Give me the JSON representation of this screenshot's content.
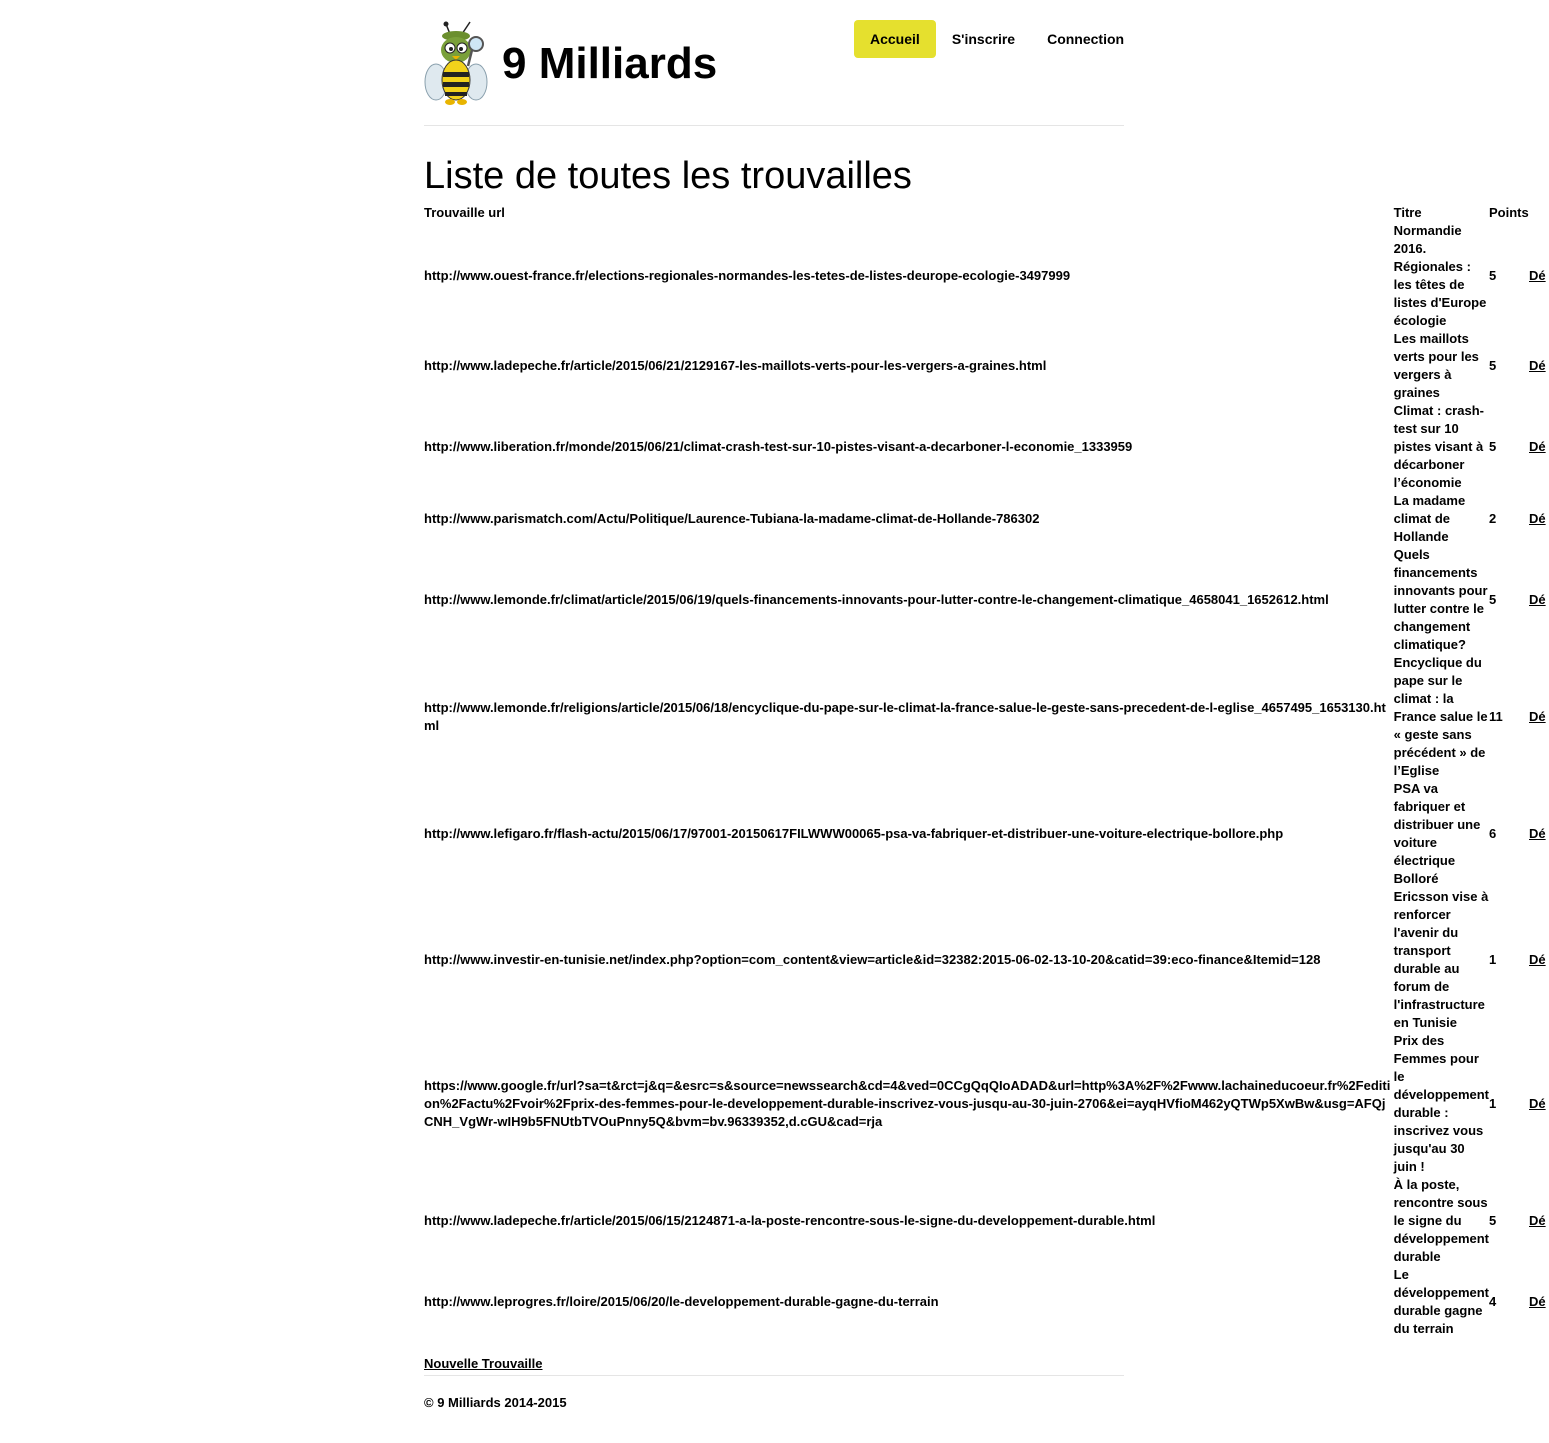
{
  "header": {
    "brand": "9 Milliards",
    "logo_icon": "bee-detective-icon",
    "nav": [
      {
        "label": "Accueil",
        "active": true
      },
      {
        "label": "S'inscrire",
        "active": false
      },
      {
        "label": "Connection",
        "active": false
      }
    ],
    "accent_color": "#e5e02e"
  },
  "main": {
    "title": "Liste de toutes les trouvailles",
    "table": {
      "headers": {
        "url": "Trouvaille url",
        "titre": "Titre",
        "points": "Points"
      },
      "rows": [
        {
          "url": "http://www.ouest-france.fr/elections-regionales-normandes-les-tetes-de-listes-deurope-ecologie-3497999",
          "titre": "Normandie 2016. Régionales : les têtes de listes d'Europe écologie",
          "points": "5",
          "action": "Dé"
        },
        {
          "url": "http://www.ladepeche.fr/article/2015/06/21/2129167-les-maillots-verts-pour-les-vergers-a-graines.html",
          "titre": "Les maillots verts pour les vergers à graines",
          "points": "5",
          "action": "Dé"
        },
        {
          "url": "http://www.liberation.fr/monde/2015/06/21/climat-crash-test-sur-10-pistes-visant-a-decarboner-l-economie_1333959",
          "titre": "Climat : crash-test sur 10 pistes visant à décarboner l’économie",
          "points": "5",
          "action": "Dé"
        },
        {
          "url": "http://www.parismatch.com/Actu/Politique/Laurence-Tubiana-la-madame-climat-de-Hollande-786302",
          "titre": "La madame climat de Hollande",
          "points": "2",
          "action": "Dé"
        },
        {
          "url": "http://www.lemonde.fr/climat/article/2015/06/19/quels-financements-innovants-pour-lutter-contre-le-changement-climatique_4658041_1652612.html",
          "titre": "Quels financements innovants pour lutter contre le changement climatique?",
          "points": "5",
          "action": "Dé"
        },
        {
          "url": "http://www.lemonde.fr/religions/article/2015/06/18/encyclique-du-pape-sur-le-climat-la-france-salue-le-geste-sans-precedent-de-l-eglise_4657495_1653130.html",
          "titre": "Encyclique du pape sur le climat : la France salue le « geste sans précédent » de l’Eglise",
          "points": "11",
          "action": "Dé"
        },
        {
          "url": "http://www.lefigaro.fr/flash-actu/2015/06/17/97001-20150617FILWWW00065-psa-va-fabriquer-et-distribuer-une-voiture-electrique-bollore.php",
          "titre": "PSA va fabriquer et distribuer une voiture électrique Bolloré",
          "points": "6",
          "action": "Dé"
        },
        {
          "url": "http://www.investir-en-tunisie.net/index.php?option=com_content&view=article&id=32382:2015-06-02-13-10-20&catid=39:eco-finance&Itemid=128",
          "titre": "Ericsson vise à renforcer l'avenir du transport durable au forum de l'infrastructure en Tunisie",
          "points": "1",
          "action": "Dé"
        },
        {
          "url": "https://www.google.fr/url?sa=t&rct=j&q=&esrc=s&source=newssearch&cd=4&ved=0CCgQqQIoADAD&url=http%3A%2F%2Fwww.lachaineducoeur.fr%2Fedition%2Factu%2Fvoir%2Fprix-des-femmes-pour-le-developpement-durable-inscrivez-vous-jusqu-au-30-juin-2706&ei=ayqHVfioM462yQTWp5XwBw&usg=AFQjCNH_VgWr-wIH9b5FNUtbTVOuPnny5Q&bvm=bv.96339352,d.cGU&cad=rja",
          "titre": "Prix des Femmes pour le développement durable : inscrivez vous jusqu'au 30 juin !",
          "points": "1",
          "action": "Dé"
        },
        {
          "url": "http://www.ladepeche.fr/article/2015/06/15/2124871-a-la-poste-rencontre-sous-le-signe-du-developpement-durable.html",
          "titre": "À la poste, rencontre sous le signe du développement durable",
          "points": "5",
          "action": "Dé"
        },
        {
          "url": "http://www.leprogres.fr/loire/2015/06/20/le-developpement-durable-gagne-du-terrain",
          "titre": "Le développement durable gagne du terrain",
          "points": "4",
          "action": "Dé"
        }
      ]
    },
    "new_link": "Nouvelle Trouvaille"
  },
  "footer": {
    "text": "© 9 Milliards 2014-2015"
  }
}
